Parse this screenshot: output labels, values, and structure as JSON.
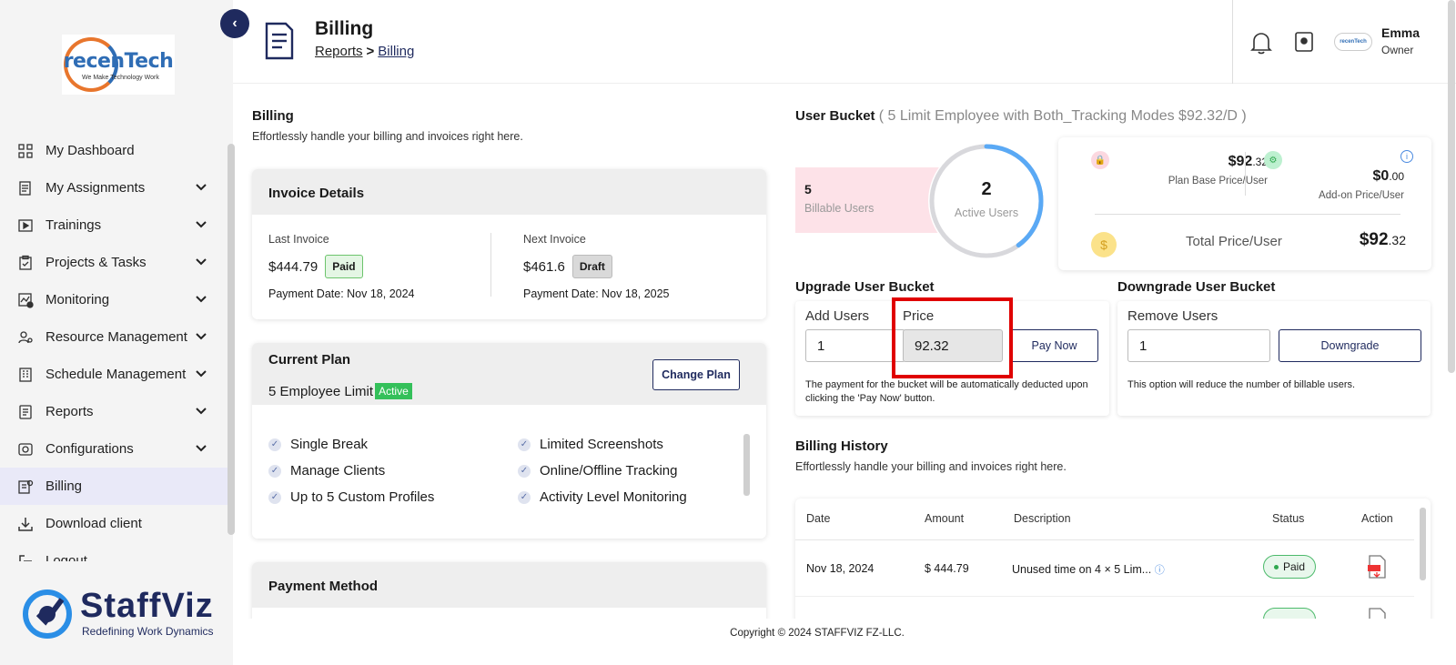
{
  "brand": {
    "name_part1": "recen",
    "name_part2": "Tech",
    "tagline": "We Make Technology Work"
  },
  "sidebar": {
    "items": [
      {
        "label": "My Dashboard"
      },
      {
        "label": "My Assignments"
      },
      {
        "label": "Trainings"
      },
      {
        "label": "Projects & Tasks"
      },
      {
        "label": "Monitoring"
      },
      {
        "label": "Resource Management"
      },
      {
        "label": "Schedule Management"
      },
      {
        "label": "Reports"
      },
      {
        "label": "Configurations"
      },
      {
        "label": "Billing"
      },
      {
        "label": "Download client"
      },
      {
        "label": "Logout"
      }
    ],
    "footer_brand": "StaffViz",
    "footer_tagline": "Redefining Work Dynamics"
  },
  "header": {
    "title": "Billing",
    "breadcrumb_parent": "Reports",
    "breadcrumb_sep": ">",
    "breadcrumb_current": "Billing",
    "user_name": "Emma",
    "user_role": "Owner",
    "mini_logo": "recenTech"
  },
  "billing": {
    "title": "Billing",
    "subtitle": "Effortlessly handle your billing and invoices right here."
  },
  "invoice": {
    "title": "Invoice Details",
    "last_label": "Last Invoice",
    "last_amount": "$444.79",
    "last_status": "Paid",
    "last_date": "Payment Date: Nov 18, 2024",
    "next_label": "Next Invoice",
    "next_amount": "$461.6",
    "next_status": "Draft",
    "next_date": "Payment Date: Nov 18, 2025"
  },
  "plan": {
    "title": "Current Plan",
    "limit": "5 Employee Limit",
    "status": "Active",
    "change_label": "Change Plan",
    "features": [
      "Single Break",
      "Limited Screenshots",
      "Manage Clients",
      "Online/Offline Tracking",
      "Up to 5 Custom Profiles",
      "Activity Level Monitoring"
    ]
  },
  "payment": {
    "title": "Payment Method"
  },
  "bucket": {
    "title": "User Bucket",
    "detail": "( 5 Limit Employee with Both_Tracking Modes $92.32/D )",
    "billable_count": "5",
    "billable_label": "Billable Users",
    "active_count": "2",
    "active_label": "Active Users",
    "active_fraction": 0.4,
    "base_price_main": "$92",
    "base_price_dec": ".32",
    "base_price_label": "Plan Base Price/User",
    "addon_price_main": "$0",
    "addon_price_dec": ".00",
    "addon_price_label": "Add-on Price/User",
    "total_label": "Total Price/User",
    "total_main": "$92",
    "total_dec": ".32"
  },
  "upgrade": {
    "title": "Upgrade User Bucket",
    "add_users_label": "Add Users",
    "add_users_value": "1",
    "price_label": "Price",
    "price_value": "92.32",
    "pay_now_label": "Pay Now",
    "note": "The payment for the bucket will be automatically deducted upon clicking the 'Pay Now' button."
  },
  "downgrade": {
    "title": "Downgrade User Bucket",
    "remove_users_label": "Remove Users",
    "remove_users_value": "1",
    "downgrade_label": "Downgrade",
    "note": "This option will reduce the number of billable users."
  },
  "history": {
    "title": "Billing History",
    "subtitle": "Effortlessly handle your billing and invoices right here.",
    "columns": [
      "Date",
      "Amount",
      "Description",
      "Status",
      "Action"
    ],
    "rows": [
      {
        "date": "Nov 18, 2024",
        "amount": "$ 444.79",
        "description": "Unused time on 4 × 5 Lim...",
        "status": "Paid"
      }
    ]
  },
  "footer": {
    "copyright": "Copyright © 2024 STAFFVIZ FZ-LLC."
  },
  "colors": {
    "navy": "#1f2a5e",
    "active_green": "#34c05a",
    "highlight_red": "#e00000",
    "pink": "#fde2e8",
    "ring_blue": "#5aa9f5"
  }
}
